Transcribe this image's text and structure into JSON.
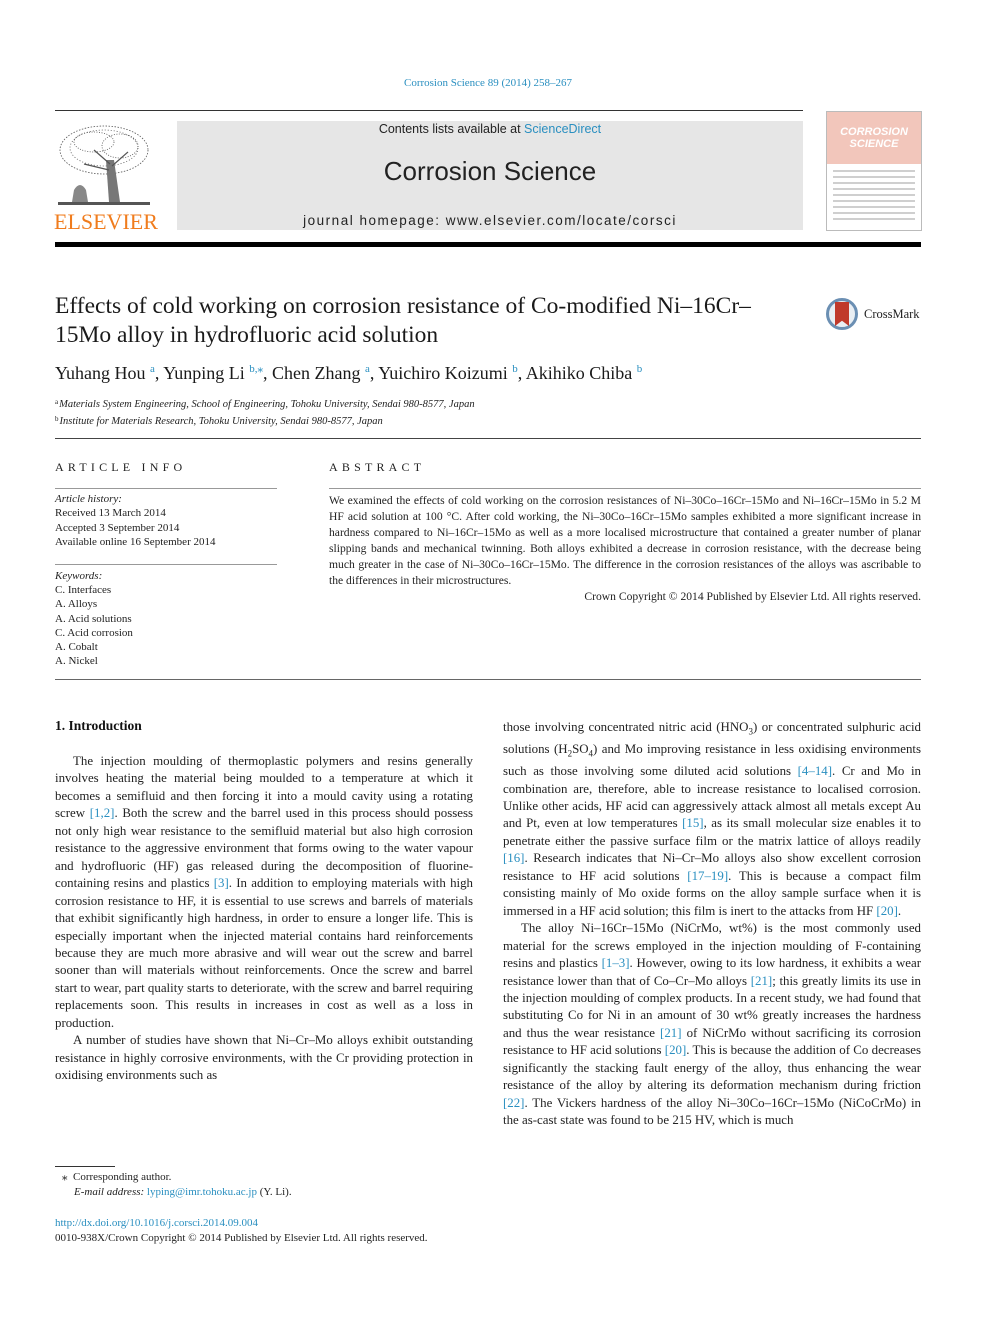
{
  "header": {
    "citation": "Corrosion Science 89 (2014) 258–267",
    "contents_prefix": "Contents lists available at ",
    "contents_link": "ScienceDirect",
    "journal_title": "Corrosion Science",
    "homepage": "journal homepage: www.elsevier.com/locate/corsci",
    "publisher_logo_text": "ELSEVIER",
    "cover_title_line1": "CORROSION",
    "cover_title_line2": "SCIENCE",
    "crossmark_label": "CrossMark"
  },
  "article": {
    "title": "Effects of cold working on corrosion resistance of Co-modified Ni–16Cr–15Mo alloy in hydrofluoric acid solution",
    "authors": [
      {
        "name": "Yuhang Hou",
        "sup": "a"
      },
      {
        "name": "Yunping Li",
        "sup": "b,⁎"
      },
      {
        "name": "Chen Zhang",
        "sup": "a"
      },
      {
        "name": "Yuichiro Koizumi",
        "sup": "b"
      },
      {
        "name": "Akihiko Chiba",
        "sup": "b"
      }
    ],
    "affiliations": [
      {
        "mark": "a",
        "text": "Materials System Engineering, School of Engineering, Tohoku University, Sendai 980-8577, Japan"
      },
      {
        "mark": "b",
        "text": "Institute for Materials Research, Tohoku University, Sendai 980-8577, Japan"
      }
    ]
  },
  "article_info": {
    "heading": "ARTICLE INFO",
    "history_label": "Article history:",
    "history": [
      "Received 13 March 2014",
      "Accepted 3 September 2014",
      "Available online 16 September 2014"
    ],
    "keywords_label": "Keywords:",
    "keywords": [
      "C. Interfaces",
      "A. Alloys",
      "A. Acid solutions",
      "C. Acid corrosion",
      "A. Cobalt",
      "A. Nickel"
    ]
  },
  "abstract": {
    "heading": "ABSTRACT",
    "text": "We examined the effects of cold working on the corrosion resistances of Ni–30Co–16Cr–15Mo and Ni–16Cr–15Mo in 5.2 M HF acid solution at 100 °C. After cold working, the Ni–30Co–16Cr–15Mo samples exhibited a more significant increase in hardness compared to Ni–16Cr–15Mo as well as a more localised microstructure that contained a greater number of planar slipping bands and mechanical twinning. Both alloys exhibited a decrease in corrosion resistance, with the decrease being much greater in the case of Ni–30Co–16Cr–15Mo. The difference in the corrosion resistances of the alloys was ascribable to the differences in their microstructures.",
    "copyright": "Crown Copyright © 2014 Published by Elsevier Ltd. All rights reserved."
  },
  "body": {
    "section_title": "1. Introduction",
    "left": {
      "p1_a": "The injection moulding of thermoplastic polymers and resins generally involves heating the material being moulded to a temperature at which it becomes a semifluid and then forcing it into a mould cavity using a rotating screw ",
      "p1_ref1": "[1,2]",
      "p1_b": ". Both the screw and the barrel used in this process should possess not only high wear resistance to the semifluid material but also high corrosion resistance to the aggressive environment that forms owing to the water vapour and hydrofluoric (HF) gas released during the decomposition of fluorine-containing resins and plastics ",
      "p1_ref2": "[3]",
      "p1_c": ". In addition to employing materials with high corrosion resistance to HF, it is essential to use screws and barrels of materials that exhibit significantly high hardness, in order to ensure a longer life. This is especially important when the injected material contains hard reinforcements because they are much more abrasive and will wear out the screw and barrel sooner than will materials without reinforcements. Once the screw and barrel start to wear, part quality starts to deteriorate, with the screw and barrel requiring replacements soon. This results in increases in cost as well as a loss in production.",
      "p2": "A number of studies have shown that Ni–Cr–Mo alloys exhibit outstanding resistance in highly corrosive environments, with the Cr providing protection in oxidising environments such as"
    },
    "right": {
      "p1_a": "those involving concentrated nitric acid (HNO",
      "p1_sub1": "3",
      "p1_b": ") or concentrated sulphuric acid solutions (H",
      "p1_sub2": "2",
      "p1_c": "SO",
      "p1_sub3": "4",
      "p1_d": ") and Mo improving resistance in less oxidising environments such as those involving some diluted acid solutions ",
      "ref_4_14": "[4–14]",
      "p1_e": ". Cr and Mo in combination are, therefore, able to increase resistance to localised corrosion. Unlike other acids, HF acid can aggressively attack almost all metals except Au and Pt, even at low temperatures ",
      "ref_15": "[15]",
      "p1_f": ", as its small molecular size enables it to penetrate either the passive surface film or the matrix lattice of alloys readily ",
      "ref_16": "[16]",
      "p1_g": ". Research indicates that Ni–Cr–Mo alloys also show excellent corrosion resistance to HF acid solutions ",
      "ref_17_19": "[17–19]",
      "p1_h": ". This is because a compact film consisting mainly of Mo oxide forms on the alloy sample surface when it is immersed in a HF acid solution; this film is inert to the attacks from HF ",
      "ref_20a": "[20]",
      "p1_i": ".",
      "p2_a": "The alloy Ni–16Cr–15Mo (NiCrMo, wt%) is the most commonly used material for the screws employed in the injection moulding of F-containing resins and plastics ",
      "ref_1_3": "[1–3]",
      "p2_b": ". However, owing to its low hardness, it exhibits a wear resistance lower than that of Co–Cr–Mo alloys ",
      "ref_21a": "[21]",
      "p2_c": "; this greatly limits its use in the injection moulding of complex products. In a recent study, we had found that substituting Co for Ni in an amount of 30 wt% greatly increases the hardness and thus the wear resistance ",
      "ref_21b": "[21]",
      "p2_d": " of NiCrMo without sacrificing its corrosion resistance to HF acid solutions ",
      "ref_20b": "[20]",
      "p2_e": ". This is because the addition of Co decreases significantly the stacking fault energy of the alloy, thus enhancing the wear resistance of the alloy by altering its deformation mechanism during friction ",
      "ref_22": "[22]",
      "p2_f": ". The Vickers hardness of the alloy Ni–30Co–16Cr–15Mo (NiCoCrMo) in the as-cast state was found to be 215 HV, which is much"
    }
  },
  "footnote": {
    "star": "⁎",
    "corresponding": "Corresponding author.",
    "email_label": "E-mail address: ",
    "email": "lyping@imr.tohoku.ac.jp",
    "email_suffix": " (Y. Li)."
  },
  "footer": {
    "doi": "http://dx.doi.org/10.1016/j.corsci.2014.09.004",
    "issn": "0010-938X/Crown Copyright © 2014 Published by Elsevier Ltd. All rights reserved."
  },
  "colors": {
    "link": "#2a8fc0",
    "elsevier_orange": "#f07c1d",
    "banner_gray": "#e6e6e6",
    "cover_pink": "#f2c6bb"
  }
}
